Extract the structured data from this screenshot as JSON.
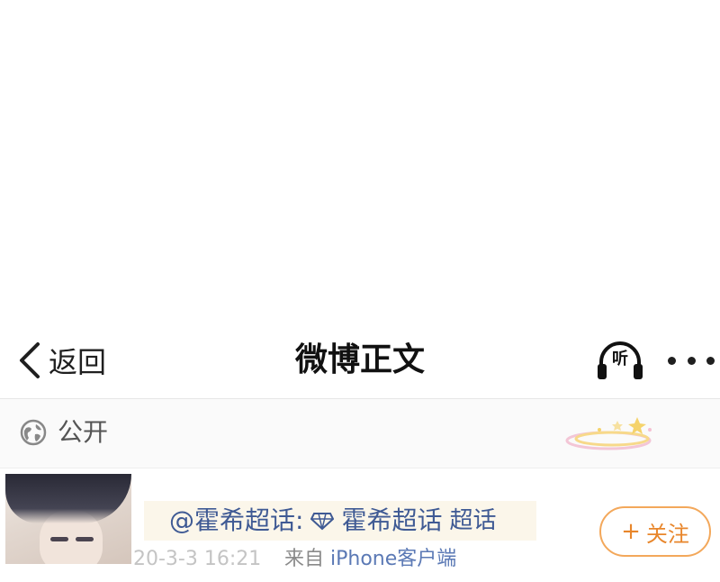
{
  "nav": {
    "back_label": "返回",
    "title": "微博正文",
    "listen_label": "听"
  },
  "visibility": {
    "label": "公开"
  },
  "post": {
    "poster_prefix": "@霍希超话:",
    "supertopic_name": "霍希超话",
    "supertopic_tag": "超话",
    "timestamp": "20-3-3 16:21",
    "source_prefix": "来自",
    "source_device": "iPhone客户端",
    "follow_label": "关注"
  },
  "colors": {
    "link_blue": "#3f5a94",
    "follow_orange": "#e8862b"
  }
}
